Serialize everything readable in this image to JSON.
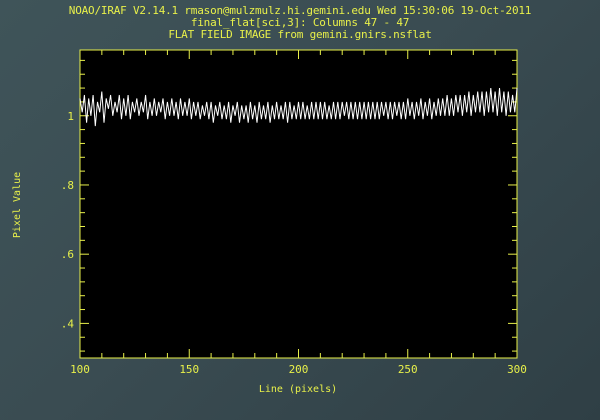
{
  "header": {
    "line1": "NOAO/IRAF V2.14.1 rmason@mulzmulz.hi.gemini.edu Wed 15:30:06 19-Oct-2011",
    "line2": "final_flat[sci,3]: Columns 47 - 47",
    "line3": "FLAT FIELD IMAGE from gemini.gnirs.nsflat"
  },
  "colors": {
    "background": "#3a4c52",
    "plot_background": "#000000",
    "axes": "#e8f04a",
    "data_line": "#ffffff",
    "text": "#e8f04a"
  },
  "chart_data": {
    "type": "line",
    "xlabel": "Line (pixels)",
    "ylabel": "Pixel Value",
    "xlim": [
      100,
      300
    ],
    "ylim": [
      0.3,
      1.19
    ],
    "x_ticks": [
      100,
      150,
      200,
      250,
      300
    ],
    "x_tick_labels": [
      "100",
      "150",
      "200",
      "250",
      "300"
    ],
    "y_ticks": [
      0.4,
      0.6,
      0.8,
      1.0
    ],
    "y_tick_labels": [
      ".4",
      ".6",
      ".8",
      "1"
    ],
    "grid": false,
    "series": [
      {
        "x": [
          100,
          101,
          102,
          103,
          104,
          105,
          106,
          107,
          108,
          109,
          110,
          111,
          112,
          113,
          114,
          115,
          116,
          117,
          118,
          119,
          120,
          121,
          122,
          123,
          124,
          125,
          126,
          127,
          128,
          129,
          130,
          131,
          132,
          133,
          134,
          135,
          136,
          137,
          138,
          139,
          140,
          141,
          142,
          143,
          144,
          145,
          146,
          147,
          148,
          149,
          150,
          151,
          152,
          153,
          154,
          155,
          156,
          157,
          158,
          159,
          160,
          161,
          162,
          163,
          164,
          165,
          166,
          167,
          168,
          169,
          170,
          171,
          172,
          173,
          174,
          175,
          176,
          177,
          178,
          179,
          180,
          181,
          182,
          183,
          184,
          185,
          186,
          187,
          188,
          189,
          190,
          191,
          192,
          193,
          194,
          195,
          196,
          197,
          198,
          199,
          200,
          201,
          202,
          203,
          204,
          205,
          206,
          207,
          208,
          209,
          210,
          211,
          212,
          213,
          214,
          215,
          216,
          217,
          218,
          219,
          220,
          221,
          222,
          223,
          224,
          225,
          226,
          227,
          228,
          229,
          230,
          231,
          232,
          233,
          234,
          235,
          236,
          237,
          238,
          239,
          240,
          241,
          242,
          243,
          244,
          245,
          246,
          247,
          248,
          249,
          250,
          251,
          252,
          253,
          254,
          255,
          256,
          257,
          258,
          259,
          260,
          261,
          262,
          263,
          264,
          265,
          266,
          267,
          268,
          269,
          270,
          271,
          272,
          273,
          274,
          275,
          276,
          277,
          278,
          279,
          280,
          281,
          282,
          283,
          284,
          285,
          286,
          287,
          288,
          289,
          290,
          291,
          292,
          293,
          294,
          295,
          296,
          297,
          298,
          299,
          300
        ],
        "y": [
          1.05,
          1.01,
          1.06,
          0.98,
          1.05,
          1.0,
          1.06,
          0.97,
          1.04,
          1.01,
          1.07,
          0.98,
          1.05,
          1.02,
          1.06,
          1.0,
          1.04,
          1.01,
          1.06,
          0.99,
          1.05,
          1.0,
          1.06,
          0.99,
          1.04,
          1.01,
          1.05,
          1.0,
          1.04,
          1.01,
          1.06,
          0.99,
          1.04,
          1.0,
          1.05,
          1.0,
          1.04,
          1.01,
          1.05,
          0.99,
          1.04,
          1.0,
          1.05,
          1.0,
          1.04,
          0.99,
          1.05,
          1.0,
          1.04,
          1.0,
          1.05,
          0.99,
          1.04,
          1.0,
          1.04,
          0.99,
          1.03,
          1.0,
          1.04,
          0.99,
          1.04,
          0.98,
          1.03,
          1.0,
          1.04,
          0.99,
          1.03,
          0.99,
          1.04,
          0.98,
          1.03,
          1.0,
          1.04,
          0.98,
          1.03,
          0.99,
          1.03,
          0.98,
          1.04,
          0.99,
          1.03,
          0.98,
          1.04,
          0.99,
          1.03,
          0.99,
          1.04,
          0.98,
          1.03,
          0.99,
          1.04,
          0.99,
          1.03,
          0.99,
          1.04,
          0.98,
          1.04,
          0.99,
          1.03,
          0.99,
          1.04,
          0.99,
          1.04,
          0.99,
          1.03,
          0.99,
          1.04,
          0.99,
          1.04,
          0.99,
          1.04,
          0.99,
          1.04,
          0.99,
          1.03,
          0.99,
          1.04,
          0.99,
          1.04,
          0.99,
          1.04,
          1.0,
          1.04,
          0.99,
          1.04,
          0.99,
          1.04,
          0.99,
          1.04,
          0.99,
          1.04,
          0.99,
          1.04,
          0.99,
          1.04,
          0.99,
          1.04,
          0.99,
          1.04,
          1.0,
          1.04,
          0.99,
          1.04,
          0.99,
          1.04,
          1.0,
          1.04,
          0.99,
          1.04,
          0.99,
          1.05,
          1.0,
          1.04,
          0.99,
          1.04,
          1.0,
          1.05,
          0.99,
          1.04,
          1.0,
          1.05,
          0.99,
          1.04,
          1.0,
          1.05,
          1.0,
          1.05,
          1.0,
          1.06,
          1.0,
          1.05,
          1.0,
          1.06,
          1.01,
          1.06,
          1.0,
          1.06,
          1.01,
          1.07,
          1.0,
          1.06,
          1.01,
          1.07,
          1.01,
          1.07,
          1.0,
          1.07,
          1.01,
          1.08,
          1.01,
          1.07,
          1.0,
          1.08,
          1.01,
          1.07,
          1.0,
          1.07,
          1.01,
          1.06,
          1.01,
          1.08
        ]
      }
    ]
  }
}
